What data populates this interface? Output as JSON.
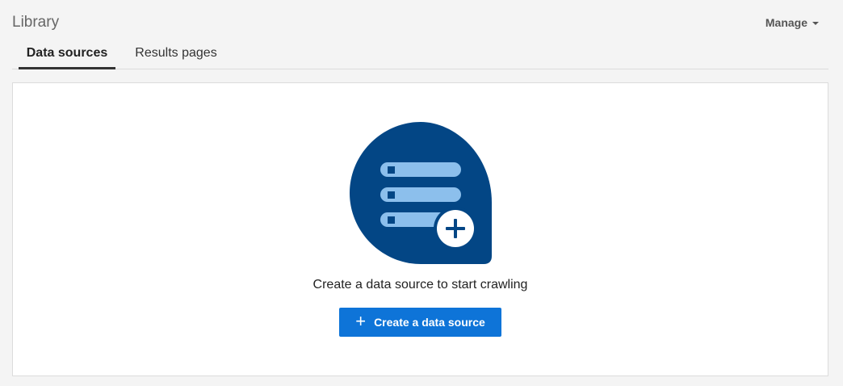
{
  "header": {
    "title": "Library",
    "manage_label": "Manage"
  },
  "tabs": [
    {
      "label": "Data sources",
      "active": true
    },
    {
      "label": "Results pages",
      "active": false
    }
  ],
  "empty_state": {
    "illustration_icon": "data-source-add-icon",
    "message": "Create a data source to start crawling",
    "button_label": "Create a data source",
    "button_icon": "plus-icon"
  },
  "colors": {
    "accent": "#0e74d8",
    "illustration_bg": "#034685",
    "illustration_bars": "#8cbfec"
  }
}
